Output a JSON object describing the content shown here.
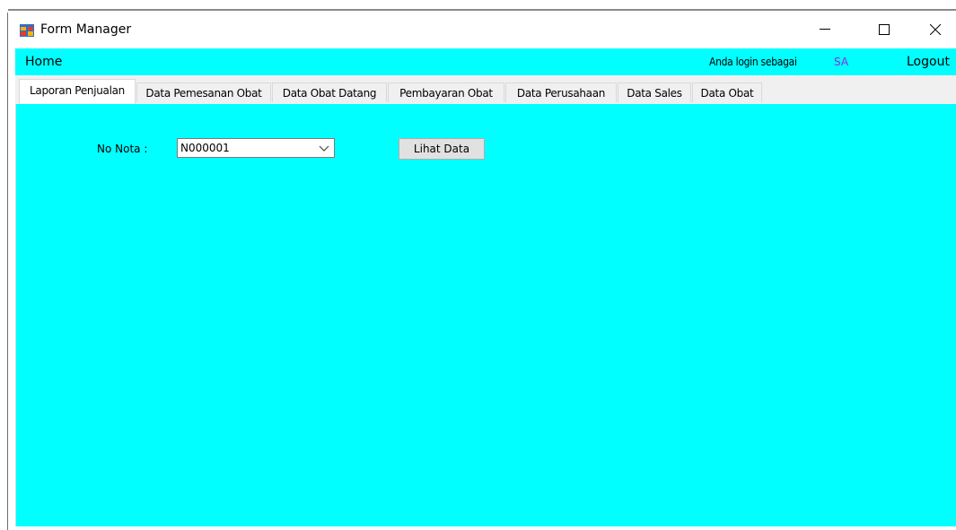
{
  "window": {
    "title": "Form Manager",
    "icon": "app-form-icon",
    "controls": [
      "minimize-icon",
      "maximize-icon",
      "close-icon"
    ]
  },
  "menubar": {
    "home": "Home",
    "login_label": "Anda login sebagai",
    "login_user": "SA",
    "logout": "Logout"
  },
  "tabs": [
    {
      "label": "Laporan Penjualan",
      "active": true
    },
    {
      "label": "Data Pemesanan Obat",
      "active": false
    },
    {
      "label": "Data Obat Datang",
      "active": false
    },
    {
      "label": "Pembayaran Obat",
      "active": false
    },
    {
      "label": "Data Perusahaan",
      "active": false
    },
    {
      "label": "Data Sales",
      "active": false
    },
    {
      "label": "Data Obat",
      "active": false
    }
  ],
  "form": {
    "nota_label": "No Nota :",
    "nota_value": "N000001",
    "lihat_button": "Lihat Data"
  },
  "colors": {
    "accent": "#00ffff",
    "user_text": "#8a2be2",
    "tab_bg": "#f0f0f0"
  }
}
